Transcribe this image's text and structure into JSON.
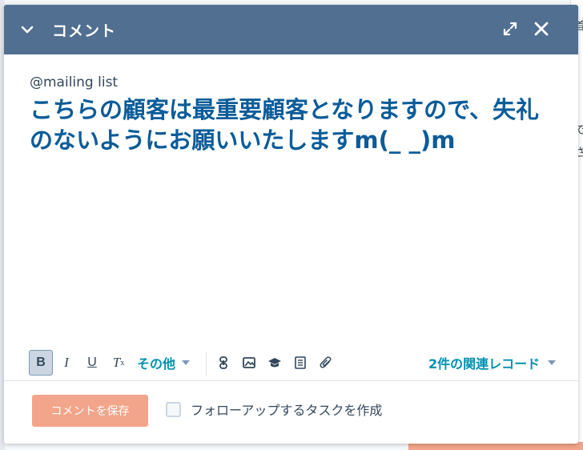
{
  "dialog": {
    "title": "コメント",
    "icons": {
      "collapse": "chevron-down-icon",
      "expand": "expand-icon",
      "close": "close-icon"
    }
  },
  "editor": {
    "mention": "@mailing list",
    "body": "こちらの顧客は最重要顧客となりますので、失礼のないようにお願いいたしますm(_ _)m"
  },
  "toolbar": {
    "bold": "B",
    "italic": "I",
    "underline": "U",
    "clear_format": "T",
    "clear_format_sub": "x",
    "more_label": "その他",
    "associations_label": "2件の関連レコード"
  },
  "footer": {
    "save_label": "コメントを保存",
    "followup_label": "フォローアップするタスクを作成"
  },
  "background": {
    "right_chars": [
      "首",
      "で",
      "さ"
    ]
  },
  "colors": {
    "header": "#516f90",
    "text_blue": "#0b5c99",
    "link": "#0091ae",
    "save_button": "#f2a58a"
  }
}
